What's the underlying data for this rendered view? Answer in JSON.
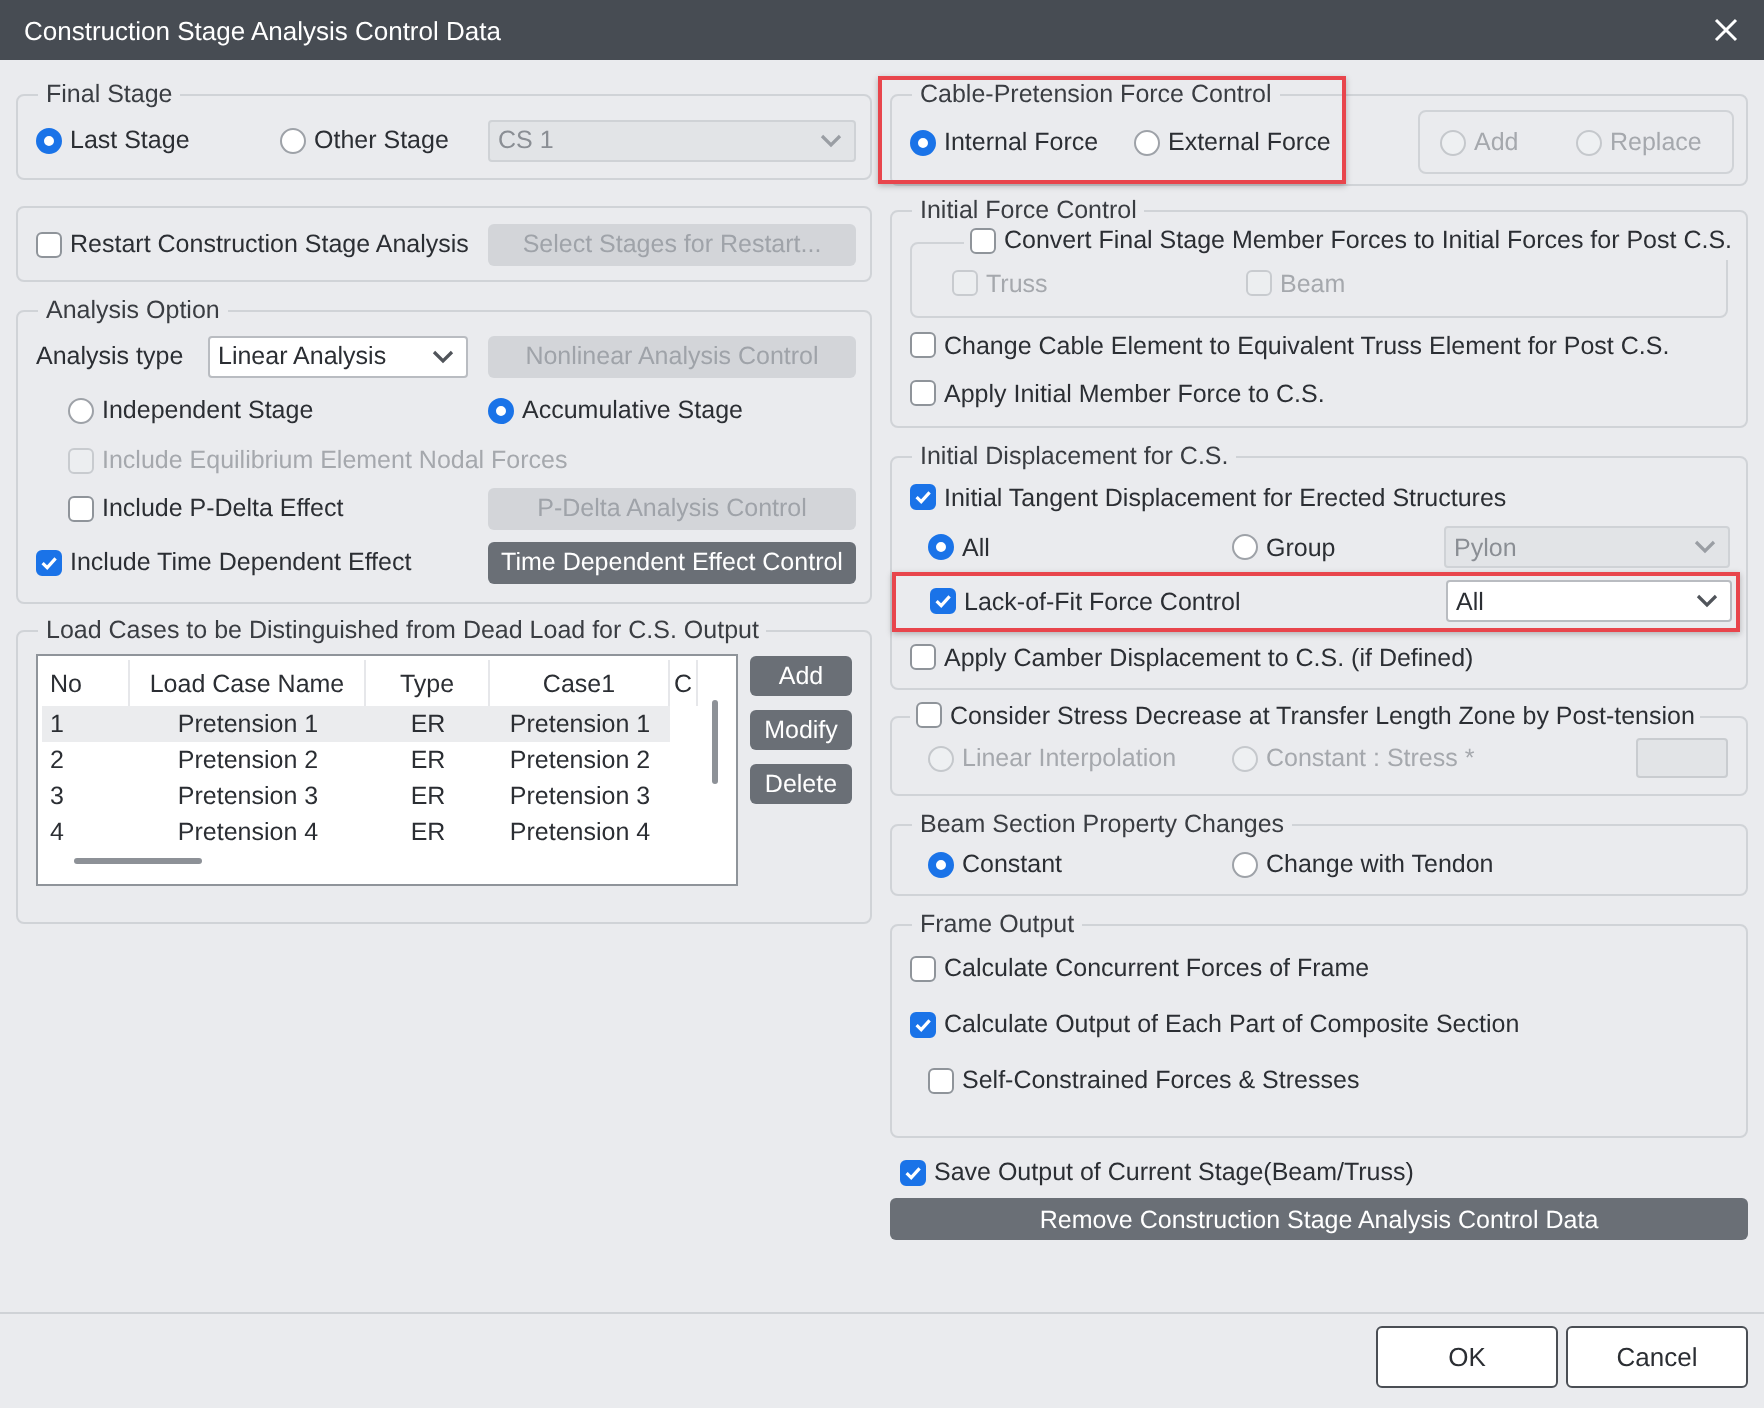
{
  "window": {
    "title": "Construction Stage Analysis Control Data"
  },
  "final_stage": {
    "title": "Final Stage",
    "options": [
      {
        "label": "Last Stage",
        "selected": true
      },
      {
        "label": "Other Stage",
        "selected": false
      }
    ],
    "stage_select": {
      "value": "CS 1",
      "disabled": true
    }
  },
  "restart": {
    "label": "Restart Construction Stage Analysis",
    "checked": false,
    "button": {
      "label": "Select Stages for Restart...",
      "disabled": true
    }
  },
  "analysis_option": {
    "title": "Analysis Option",
    "type_label": "Analysis type",
    "type_select": {
      "value": "Linear Analysis",
      "disabled": false
    },
    "nonlinear_button": {
      "label": "Nonlinear Analysis Control",
      "disabled": true
    },
    "stage_modes": [
      {
        "label": "Independent Stage",
        "selected": false
      },
      {
        "label": "Accumulative Stage",
        "selected": true
      }
    ],
    "equilibrium": {
      "label": "Include Equilibrium Element Nodal Forces",
      "checked": false,
      "disabled": true
    },
    "p_delta": {
      "label": "Include P-Delta Effect",
      "checked": false,
      "disabled": false
    },
    "p_delta_button": {
      "label": "P-Delta Analysis Control",
      "disabled": true
    },
    "time_dependent": {
      "label": "Include Time Dependent Effect",
      "checked": true,
      "disabled": false
    },
    "time_dependent_button": {
      "label": "Time Dependent Effect Control",
      "disabled": false
    }
  },
  "load_cases": {
    "title": "Load Cases to be Distinguished from Dead Load for C.S. Output",
    "columns": [
      "No",
      "Load Case Name",
      "Type",
      "Case1",
      "C"
    ],
    "rows": [
      {
        "cells": [
          "1",
          "Pretension 1",
          "ER",
          "Pretension 1"
        ],
        "selected": true
      },
      {
        "cells": [
          "2",
          "Pretension 2",
          "ER",
          "Pretension 2"
        ],
        "selected": false
      },
      {
        "cells": [
          "3",
          "Pretension 3",
          "ER",
          "Pretension 3"
        ],
        "selected": false
      },
      {
        "cells": [
          "4",
          "Pretension 4",
          "ER",
          "Pretension 4"
        ],
        "selected": false
      }
    ],
    "buttons": [
      {
        "label": "Add"
      },
      {
        "label": "Modify"
      },
      {
        "label": "Delete"
      }
    ]
  },
  "cable_pretension": {
    "title": "Cable-Pretension Force Control",
    "highlighted": true,
    "options": [
      {
        "label": "Internal Force",
        "selected": true
      },
      {
        "label": "External Force",
        "selected": false
      }
    ],
    "mode_options": [
      {
        "label": "Add",
        "selected": false,
        "disabled": true
      },
      {
        "label": "Replace",
        "selected": false,
        "disabled": true
      }
    ]
  },
  "initial_force": {
    "title": "Initial Force Control",
    "convert": {
      "label": "Convert Final Stage Member Forces to Initial Forces for Post C.S.",
      "checked": false,
      "disabled": false
    },
    "convert_options": [
      {
        "label": "Truss",
        "checked": false,
        "disabled": true
      },
      {
        "label": "Beam",
        "checked": false,
        "disabled": true
      }
    ],
    "checks": [
      {
        "label": "Change Cable Element to Equivalent Truss Element for Post C.S.",
        "checked": false,
        "disabled": false
      },
      {
        "label": "Apply Initial Member Force to C.S.",
        "checked": false,
        "disabled": false
      }
    ]
  },
  "initial_displacement": {
    "title": "Initial Displacement for C.S.",
    "tangent": {
      "label": "Initial Tangent Displacement for Erected Structures",
      "checked": true,
      "disabled": false
    },
    "scope_options": [
      {
        "label": "All",
        "selected": true
      },
      {
        "label": "Group",
        "selected": false
      }
    ],
    "group_select": {
      "value": "Pylon",
      "disabled": true
    },
    "lack_of_fit": {
      "label": "Lack-of-Fit Force Control",
      "checked": true,
      "disabled": false,
      "highlighted": true,
      "select": {
        "value": "All",
        "disabled": false
      }
    },
    "camber": {
      "label": "Apply Camber Displacement to C.S. (if Defined)",
      "checked": false,
      "disabled": false
    }
  },
  "stress_decrease": {
    "label": "Consider Stress Decrease at Transfer Length Zone by Post-tension",
    "checked": false,
    "disabled": false,
    "options": [
      {
        "label": "Linear Interpolation",
        "selected": false,
        "disabled": true
      },
      {
        "label": "Constant : Stress *",
        "selected": false,
        "disabled": true
      }
    ],
    "stress_field": {
      "disabled": true
    }
  },
  "beam_section": {
    "title": "Beam Section Property Changes",
    "options": [
      {
        "label": "Constant",
        "selected": true
      },
      {
        "label": "Change with Tendon",
        "selected": false
      }
    ]
  },
  "frame_output": {
    "title": "Frame Output",
    "checks": [
      {
        "label": "Calculate Concurrent Forces of Frame",
        "checked": false,
        "disabled": false
      },
      {
        "label": "Calculate Output of Each Part of Composite Section",
        "checked": true,
        "disabled": false,
        "children": [
          {
            "label": "Self-Constrained Forces & Stresses",
            "checked": false,
            "disabled": false
          }
        ]
      }
    ]
  },
  "save_output": {
    "label": "Save Output of Current Stage(Beam/Truss)",
    "checked": true,
    "disabled": false
  },
  "remove_button": {
    "label": "Remove Construction Stage Analysis Control Data"
  },
  "footer_buttons": [
    {
      "label": "OK"
    },
    {
      "label": "Cancel"
    }
  ]
}
